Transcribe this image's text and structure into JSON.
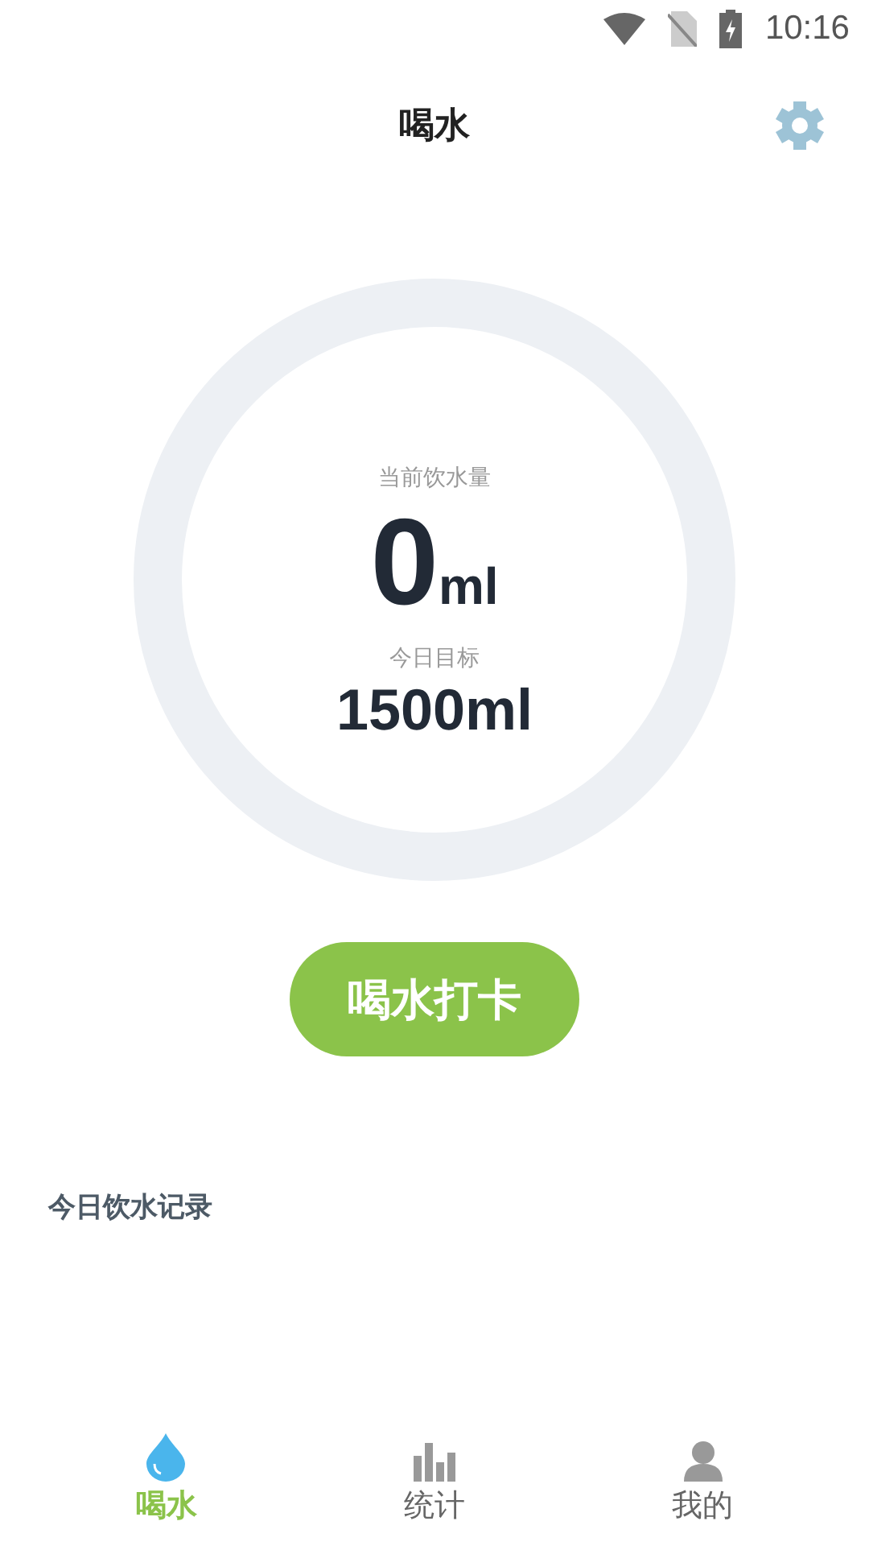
{
  "status_bar": {
    "time": "10:16"
  },
  "header": {
    "title": "喝水"
  },
  "progress": {
    "caption": "当前饮水量",
    "amount": "0",
    "unit": "ml",
    "goal_label": "今日目标",
    "goal": "1500ml"
  },
  "checkin_button": "喝水打卡",
  "records": {
    "title": "今日饮水记录"
  },
  "tabs": [
    {
      "label": "喝水",
      "kind": "drop",
      "selected": true
    },
    {
      "label": "统计",
      "kind": "chart",
      "selected": false
    },
    {
      "label": "我的",
      "kind": "person",
      "selected": false
    }
  ]
}
